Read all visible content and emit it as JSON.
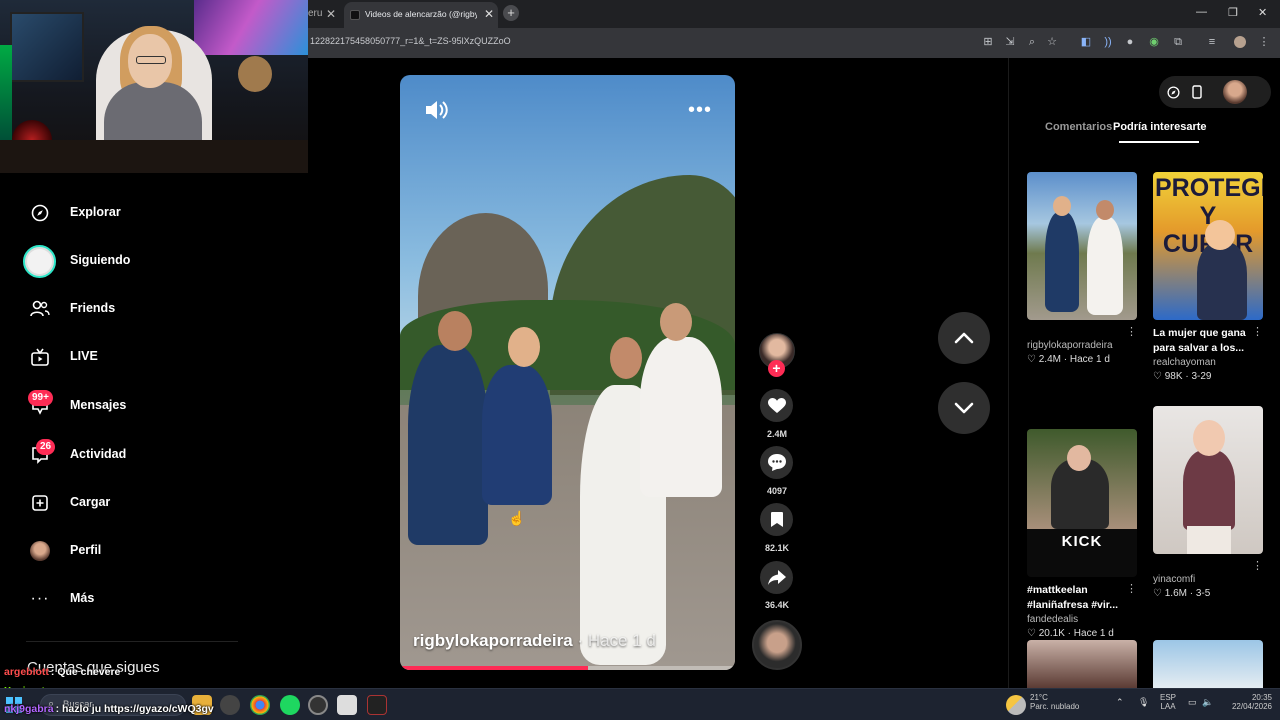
{
  "browser": {
    "prev_tab_fragment": "eru",
    "active_tab_title": "Videos de alencarzão (@rigbylo...",
    "url_fragment": "122822175458050777_r=1&_t=ZS-95lXzQUZZoO"
  },
  "sidebar": {
    "items": [
      {
        "label": "Explorar",
        "icon": "compass-icon"
      },
      {
        "label": "Siguiendo",
        "icon": "following-avatar-icon"
      },
      {
        "label": "Friends",
        "icon": "friends-icon"
      },
      {
        "label": "LIVE",
        "icon": "live-tv-icon"
      },
      {
        "label": "Mensajes",
        "icon": "messages-icon",
        "badge": "99+"
      },
      {
        "label": "Actividad",
        "icon": "activity-icon",
        "badge": "26"
      },
      {
        "label": "Cargar",
        "icon": "upload-icon"
      },
      {
        "label": "Perfil",
        "icon": "profile-avatar-icon"
      },
      {
        "label": "Más",
        "icon": "more-icon"
      }
    ],
    "following_title": "Cuentas que sigues"
  },
  "chat": [
    {
      "user": "argeblott",
      "message": ": Que chevere",
      "color": "#ff4d4d"
    },
    {
      "user": "Xavier_ty",
      "message": ": pasame ese",
      "color": "#7fff00"
    },
    {
      "user": "nkj9gabra",
      "message": ": hazlo ju https://gyazo/cWQ3gv",
      "color": "#b266ff"
    }
  ],
  "video": {
    "author": "rigbylokaporradeira",
    "separator": "·",
    "time": "Hace 1 d",
    "progress": 0.56
  },
  "actions": {
    "likes": "2.4M",
    "comments": "4097",
    "saves": "82.1K",
    "shares": "36.4K"
  },
  "right_panel": {
    "tabs": [
      "Comentarios",
      "Podría interesarte"
    ],
    "active_tab": 1,
    "cards": [
      {
        "title": "",
        "author": "rigbylokaporradeira",
        "likes": "2.4M",
        "date": "Hace 1 d",
        "thumb_text": ""
      },
      {
        "title": "La mujer que gana para salvar a los...",
        "author": "realchayoman",
        "likes": "98K",
        "date": "3-29",
        "thumb_text": "PROTEGER Y CURAR"
      },
      {
        "title": "#mattkeelan #laniñafresa #vir...",
        "author": "fandedealis",
        "likes": "20.1K",
        "date": "Hace 1 d",
        "thumb_text": "KICK"
      },
      {
        "title": "",
        "author": "yinacomfi",
        "likes": "1.6M",
        "date": "3-5",
        "thumb_text": ""
      }
    ]
  },
  "taskbar": {
    "search_placeholder": "Buscar",
    "weather_temp": "21°C",
    "weather_desc": "Parc. nublado",
    "language": "ESP",
    "layout": "LAA",
    "time": "20:35",
    "date": "22/04/2026"
  },
  "colors": {
    "accent": "#fe2c55",
    "panel_bg": "#000000",
    "button_bg": "#2f2f2f"
  }
}
